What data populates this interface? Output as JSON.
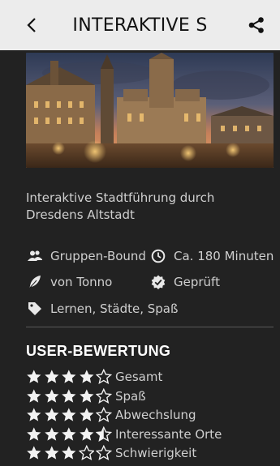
{
  "header": {
    "title": "INTERAKTIVE S",
    "back_icon": "chevron-left-icon",
    "share_icon": "share-icon"
  },
  "tour": {
    "description": "Interaktive Stadtführung durch Dresdens Altstadt",
    "group_type": "Gruppen-Bound",
    "duration": "Ca. 180 Minuten",
    "author": "von Tonno",
    "status": "Geprüft",
    "tags": "Lernen, Städte, Spaß"
  },
  "ratings": {
    "title": "USER-BEWERTUNG",
    "items": [
      {
        "label": "Gesamt",
        "stars": 4
      },
      {
        "label": "Spaß",
        "stars": 4
      },
      {
        "label": "Abwechslung",
        "stars": 4
      },
      {
        "label": "Interessante Orte",
        "stars": 4.5
      },
      {
        "label": "Schwierigkeit",
        "stars": 3
      }
    ]
  },
  "colors": {
    "background": "#222222",
    "header": "#ececec"
  }
}
